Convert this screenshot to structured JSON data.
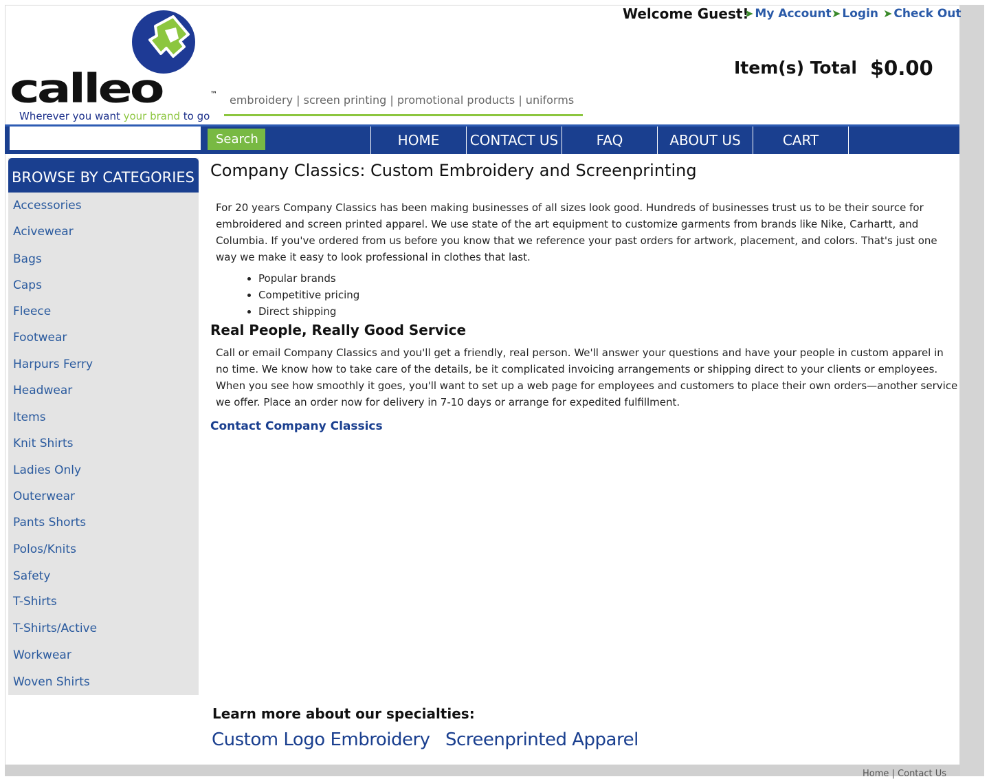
{
  "brand": {
    "logo_word": "calleo",
    "logo_tm": "™",
    "logo_tagline_part1": "Wherever you want ",
    "logo_tagline_part2": "your brand",
    "logo_tagline_part3": " to go",
    "tagline": "embroidery | screen printing | promotional products | uniforms",
    "colors": {
      "blue": "#1a3f8f",
      "green": "#8cc63f"
    }
  },
  "header": {
    "welcome": "Welcome Guest!",
    "links": [
      "My Account",
      "Login",
      "Check Out"
    ],
    "items_label": "Item(s) Total",
    "items_total": "$0.00"
  },
  "nav": {
    "search_placeholder": "",
    "search_label": "Search",
    "items": [
      "HOME",
      "CONTACT US",
      "FAQ",
      "ABOUT US",
      "CART"
    ]
  },
  "sidebar": {
    "header": "BROWSE BY CATEGORIES",
    "categories": [
      "Accessories",
      "Acivewear",
      "Bags",
      "Caps",
      "Fleece",
      "Footwear",
      "Harpurs Ferry",
      "Headwear",
      "Items",
      "Knit Shirts",
      "Ladies Only",
      "Outerwear",
      "Pants Shorts",
      "Polos/Knits",
      "Safety",
      "T-Shirts",
      "T-Shirts/Active",
      "Workwear",
      "Woven Shirts"
    ]
  },
  "main": {
    "title": "Company Classics: Custom Embroidery and Screenprinting",
    "intro": "For 20 years Company Classics has been making businesses of all sizes look good. Hundreds of businesses trust us to be their source for embroidered and screen printed apparel. We use state of the art equipment to customize garments from brands like Nike, Carhartt, and Columbia. If you've ordered from us before you know that we reference your past orders for artwork, placement, and colors. That's just one way we make it easy to look professional in clothes that last.",
    "bullets": [
      "Popular brands",
      "Competitive pricing",
      "Direct shipping"
    ],
    "section2_title": "Real People, Really Good Service",
    "section2_body": "Call or email Company Classics and you'll get a friendly, real person. We'll answer your questions and have your people in custom apparel in no time. We know how to take care of the details, be it complicated invoicing arrangements or shipping direct to your clients or employees. When you see how smoothly it goes, you'll want to set up a web page for employees and customers to place their own orders—another service we offer. Place an order now for delivery in 7-10 days or arrange for expedited fulfillment.",
    "contact_link": "Contact Company Classics"
  },
  "specialties": {
    "title": "Learn more about our specialties:",
    "links": [
      "Custom Logo Embroidery",
      "Screenprinted Apparel"
    ]
  },
  "footer": {
    "links": "Home | Contact Us"
  }
}
